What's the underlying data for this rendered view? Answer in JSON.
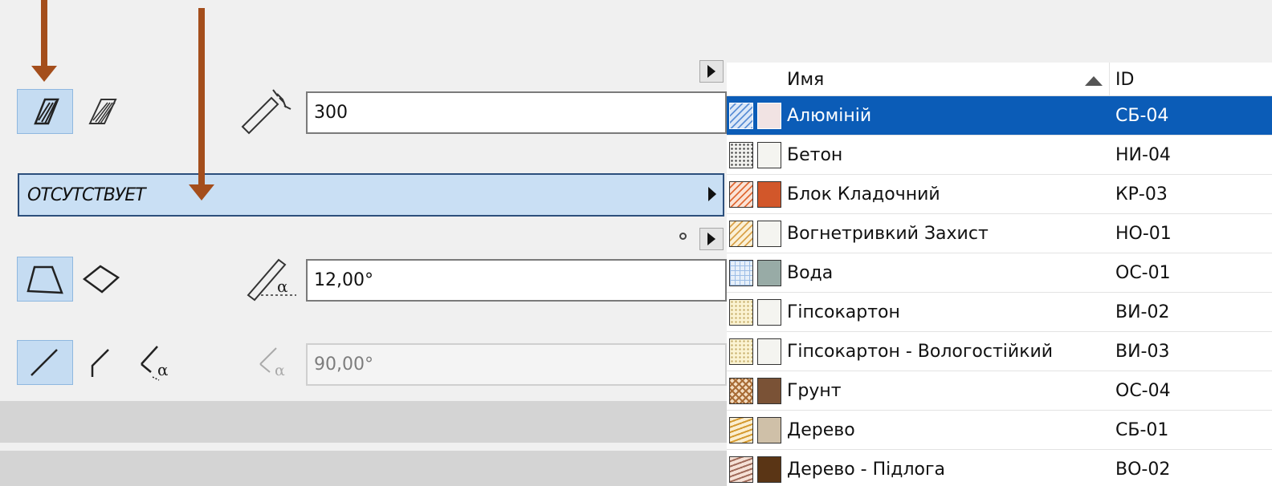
{
  "panel": {
    "thickness_value": "300",
    "fill_dropdown": "ОТСУТСТВУЕТ",
    "slope_angle_value": "12,00°",
    "edge_angle_value": "90,00°"
  },
  "icons": {
    "fill_solid": "hatched-slab-icon",
    "fill_layered": "layered-slab-icon",
    "thickness": "thickness-icon",
    "shape_trapezoid": "trapezoid-icon",
    "shape_rotated": "rotated-trapezoid-icon",
    "edge_vertical": "vertical-edge-icon",
    "edge_angled": "angled-edge-icon",
    "edge_custom": "custom-angle-edge-icon",
    "slope_angle": "slope-angle-icon",
    "edge_angle": "edge-angle-icon"
  },
  "table": {
    "columns": [
      "Имя",
      "ID"
    ],
    "rows": [
      {
        "name": "Алюміній",
        "id": "СБ-04",
        "pattern": "diag",
        "pattern_bg": "#dbe8f8",
        "pattern_fg": "#5b8fd6",
        "color": "#f1e3e3",
        "selected": true
      },
      {
        "name": "Бетон",
        "id": "НИ-04",
        "pattern": "dots",
        "pattern_bg": "#f1f1ee",
        "pattern_fg": "#444444",
        "color": "#f4f4f0",
        "selected": false
      },
      {
        "name": "Блок Кладочний",
        "id": "КР-03",
        "pattern": "diag",
        "pattern_bg": "#fbe3d6",
        "pattern_fg": "#e06a36",
        "color": "#d2572a",
        "selected": false
      },
      {
        "name": "Вогнетривкий Захист",
        "id": "НО-01",
        "pattern": "diag",
        "pattern_bg": "#fbf0d6",
        "pattern_fg": "#d9a24a",
        "color": "#f4f4f0",
        "selected": false
      },
      {
        "name": "Вода",
        "id": "ОС-01",
        "pattern": "grid",
        "pattern_bg": "#e6eff9",
        "pattern_fg": "#9cbde6",
        "color": "#98aba6",
        "selected": false
      },
      {
        "name": "Гіпсокартон",
        "id": "ВИ-02",
        "pattern": "dots",
        "pattern_bg": "#fbf3d2",
        "pattern_fg": "#c9b271",
        "color": "#f4f4f0",
        "selected": false
      },
      {
        "name": "Гіпсокартон - Вологостійкий",
        "id": "ВИ-03",
        "pattern": "dots",
        "pattern_bg": "#fbf3d2",
        "pattern_fg": "#c9b271",
        "color": "#f4f4f0",
        "selected": false
      },
      {
        "name": "Грунт",
        "id": "ОС-04",
        "pattern": "cross",
        "pattern_bg": "#f3dcc0",
        "pattern_fg": "#a86c36",
        "color": "#7a5236",
        "selected": false
      },
      {
        "name": "Дерево",
        "id": "СБ-01",
        "pattern": "wave",
        "pattern_bg": "#fbeed0",
        "pattern_fg": "#d49a30",
        "color": "#cfc0a8",
        "selected": false
      },
      {
        "name": "Дерево - Підлога",
        "id": "ВО-02",
        "pattern": "wave",
        "pattern_bg": "#f6e1d6",
        "pattern_fg": "#a06b5a",
        "color": "#5a3515",
        "selected": false
      }
    ]
  },
  "colors": {
    "annotation_arrow": "#a44e1c",
    "selection": "#0b5cb7",
    "toggle_selected": "#c5dcf2"
  }
}
